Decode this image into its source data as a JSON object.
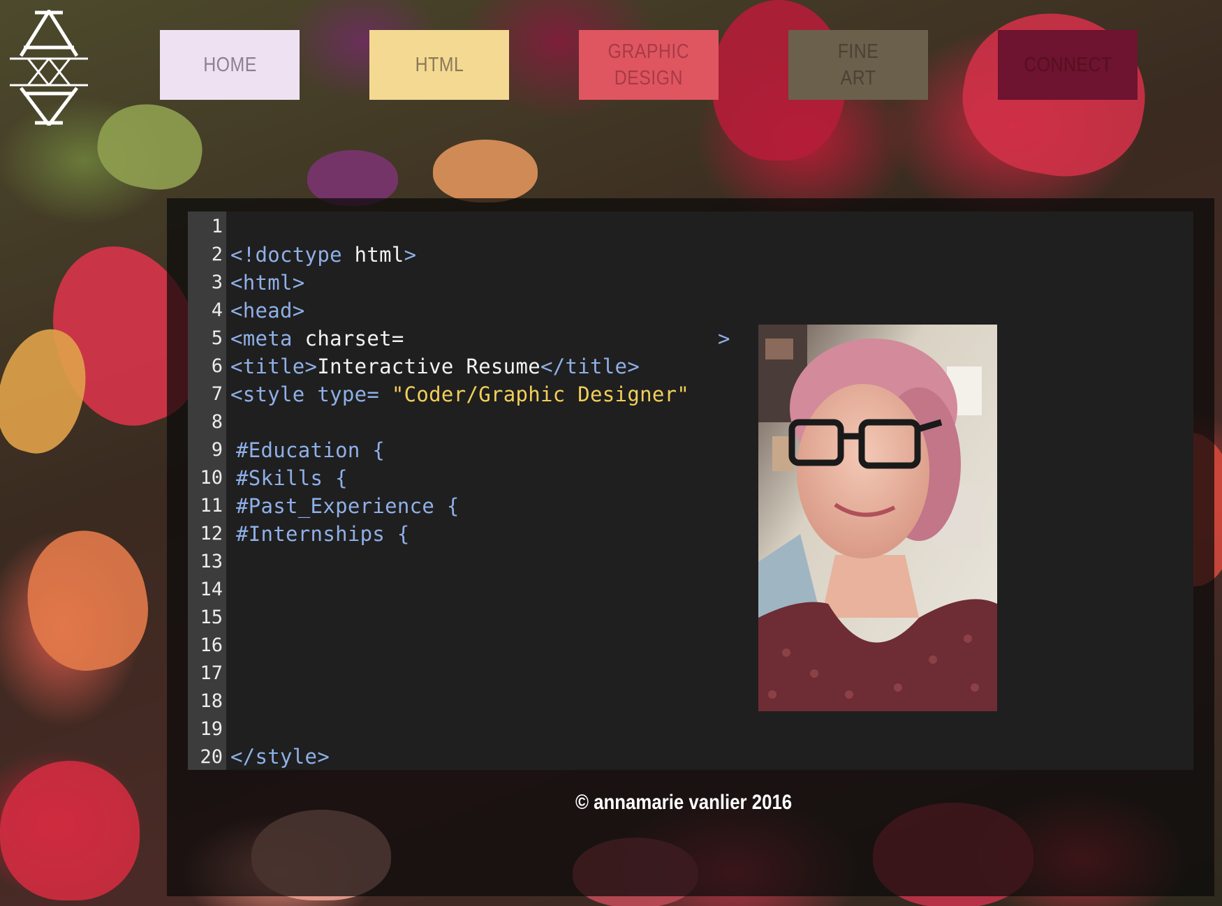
{
  "nav": {
    "items": [
      {
        "label": "HOME",
        "bg": "#eee2f2",
        "fg": "#8a8290"
      },
      {
        "label": "HTML",
        "bg": "#f4d993",
        "fg": "#8a7a56"
      },
      {
        "label": "GRAPHIC\nDESIGN",
        "bg": "#df5660",
        "fg": "#a83a46"
      },
      {
        "label": "FINE\nART",
        "bg": "#6b604c",
        "fg": "#4a4234"
      },
      {
        "label": "CONNECT",
        "bg": "#6e1330",
        "fg": "#55101f"
      }
    ]
  },
  "editor": {
    "line_numbers": [
      "1",
      "2",
      "3",
      "4",
      "5",
      "6",
      "7",
      "8",
      "9",
      "10",
      "11",
      "12",
      "13",
      "14",
      "15",
      "16",
      "17",
      "18",
      "19",
      "20"
    ],
    "lines": {
      "l2_tag": "<!doctype",
      "l2_txt": " html",
      "l2_end": ">",
      "l3": "<html>",
      "l4": "<head>",
      "l5_tag": "<meta",
      "l5_txt": " charset=",
      "l5_end": ">",
      "l6_open": "<title>",
      "l6_txt": "Interactive Resume",
      "l6_close": "</title>",
      "l6_end": ">",
      "l7_tag": "<style type=",
      "l7_str": "\"Coder/Graphic Designer\"",
      "l7_end": ">",
      "l9": "#Education {",
      "l10": "#Skills {",
      "l11": "#Past_Experience {",
      "l12": "#Internships {",
      "l20": "</style>"
    }
  },
  "photo": {
    "alt": "portrait-photo"
  },
  "footer": {
    "text": "© annamarie vanlier 2016"
  }
}
